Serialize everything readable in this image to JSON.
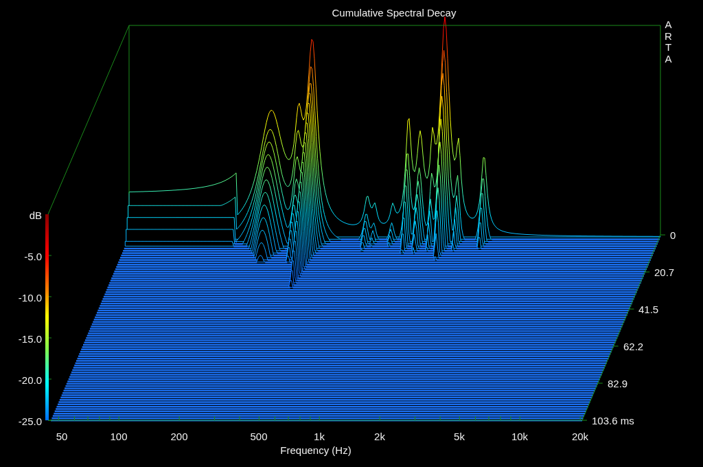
{
  "chart": {
    "title": "Cumulative Spectral Decay",
    "brand": "ARTA",
    "z_unit": "dB",
    "z_ticks": [
      "-5.0",
      "-10.0",
      "-15.0",
      "-20.0",
      "-25.0"
    ],
    "time_ticks": [
      "0",
      "20.7",
      "41.5",
      "62.2",
      "82.9",
      "103.6 ms"
    ],
    "freq_ticks": [
      "50",
      "100",
      "200",
      "500",
      "1k",
      "2k",
      "5k",
      "10k",
      "20k"
    ],
    "xlabel": "Frequency (Hz)"
  }
}
